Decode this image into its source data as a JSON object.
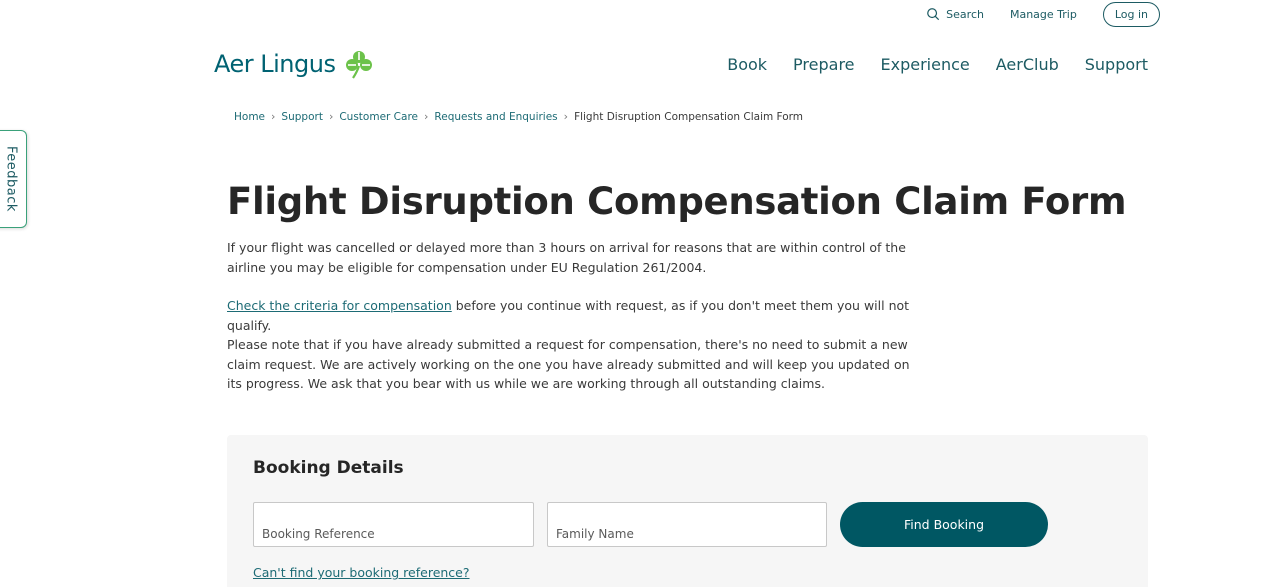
{
  "utility": {
    "search_label": "Search",
    "manage_trip_label": "Manage Trip",
    "login_label": "Log in"
  },
  "brand": {
    "name": "Aer Lingus",
    "logo_icon": "shamrock-icon",
    "primary_color": "#006272",
    "shamrock_color": "#6cc24a"
  },
  "nav": {
    "items": [
      {
        "label": "Book"
      },
      {
        "label": "Prepare"
      },
      {
        "label": "Experience"
      },
      {
        "label": "AerClub"
      },
      {
        "label": "Support"
      }
    ]
  },
  "breadcrumb": {
    "items": [
      {
        "label": "Home"
      },
      {
        "label": "Support"
      },
      {
        "label": "Customer Care"
      },
      {
        "label": "Requests and Enquiries"
      }
    ],
    "current": "Flight Disruption Compensation Claim Form"
  },
  "feedback": {
    "label": "Feedback"
  },
  "page": {
    "title": "Flight Disruption Compensation Claim Form",
    "intro": "If your flight was cancelled or delayed more than 3 hours on arrival for reasons that are within control of the airline you may be eligible for compensation under EU Regulation 261/2004.",
    "criteria_link": "Check the criteria for compensation",
    "criteria_rest": " before you continue with request, as if you don't meet them you will not qualify.",
    "note": "Please note that if you have already submitted a request for compensation, there's no need to submit a new claim request. We are actively working on the one you have already submitted and will keep you updated on its progress. We ask that you bear with us while we are working through all outstanding claims."
  },
  "booking": {
    "title": "Booking Details",
    "reference_placeholder": "Booking Reference",
    "family_name_placeholder": "Family Name",
    "find_button": "Find Booking",
    "cant_find_link": "Can't find your booking reference?"
  }
}
